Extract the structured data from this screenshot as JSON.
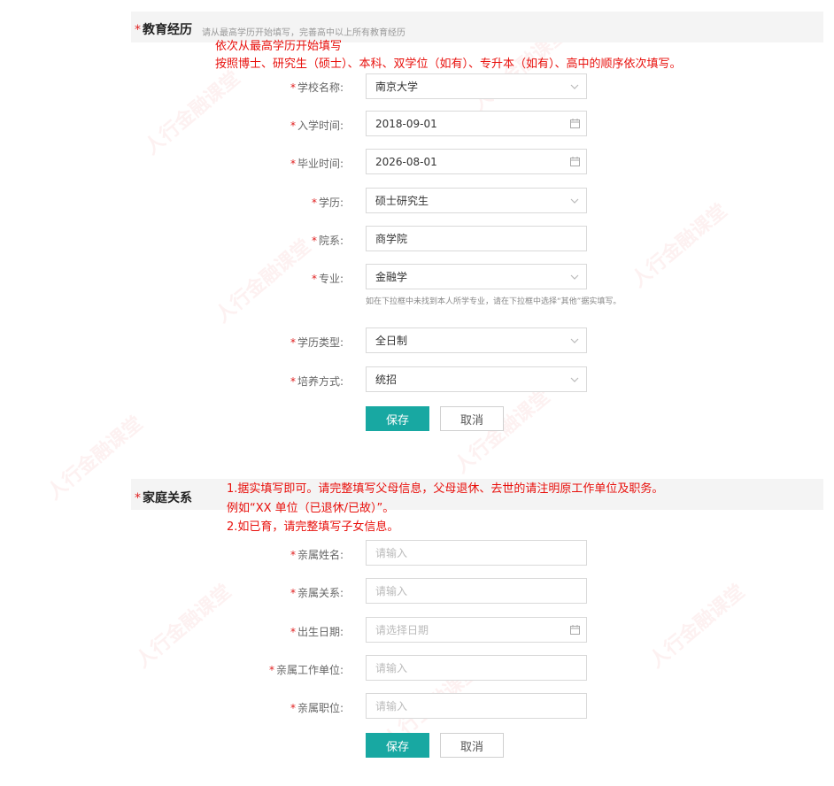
{
  "education": {
    "title": "教育经历",
    "subtitle": "请从最高学历开始填写，完善高中以上所有教育经历",
    "note_line1": "依次从最高学历开始填写",
    "note_line2": "按照博士、研究生（硕士）、本科、双学位（如有）、专升本（如有）、高中的顺序依次填写。",
    "fields": {
      "school": {
        "label": "学校名称:",
        "value": "南京大学"
      },
      "start": {
        "label": "入学时间:",
        "value": "2018-09-01"
      },
      "end": {
        "label": "毕业时间:",
        "value": "2026-08-01"
      },
      "degree": {
        "label": "学历:",
        "value": "硕士研究生"
      },
      "department": {
        "label": "院系:",
        "value": "商学院"
      },
      "major": {
        "label": "专业:",
        "value": "金融学"
      },
      "major_help": "如在下拉框中未找到本人所学专业，请在下拉框中选择“其他”据实填写。",
      "edu_type": {
        "label": "学历类型:",
        "value": "全日制"
      },
      "training": {
        "label": "培养方式:",
        "value": "统招"
      }
    },
    "save_label": "保存",
    "cancel_label": "取消"
  },
  "family": {
    "title": "家庭关系",
    "note_line1": "1.据实填写即可。请完整填写父母信息，父母退休、去世的请注明原工作单位及职务。",
    "note_line2": "例如“XX 单位（已退休/已故）”。",
    "note_line3": "2.如已育，请完整填写子女信息。",
    "fields": {
      "name": {
        "label": "亲属姓名:",
        "placeholder": "请输入"
      },
      "relation": {
        "label": "亲属关系:",
        "placeholder": "请输入"
      },
      "birth": {
        "label": "出生日期:",
        "placeholder": "请选择日期"
      },
      "employer": {
        "label": "亲属工作单位:",
        "placeholder": "请输入"
      },
      "position": {
        "label": "亲属职位:",
        "placeholder": "请输入"
      }
    },
    "save_label": "保存",
    "cancel_label": "取消"
  },
  "required_mark": "*",
  "watermark_text": "人行金融课堂",
  "colors": {
    "accent": "#18a8a2",
    "required": "#e02020",
    "note": "#e8100c"
  },
  "icons": {
    "dropdown": "chevron-down-icon",
    "date": "calendar-icon"
  }
}
